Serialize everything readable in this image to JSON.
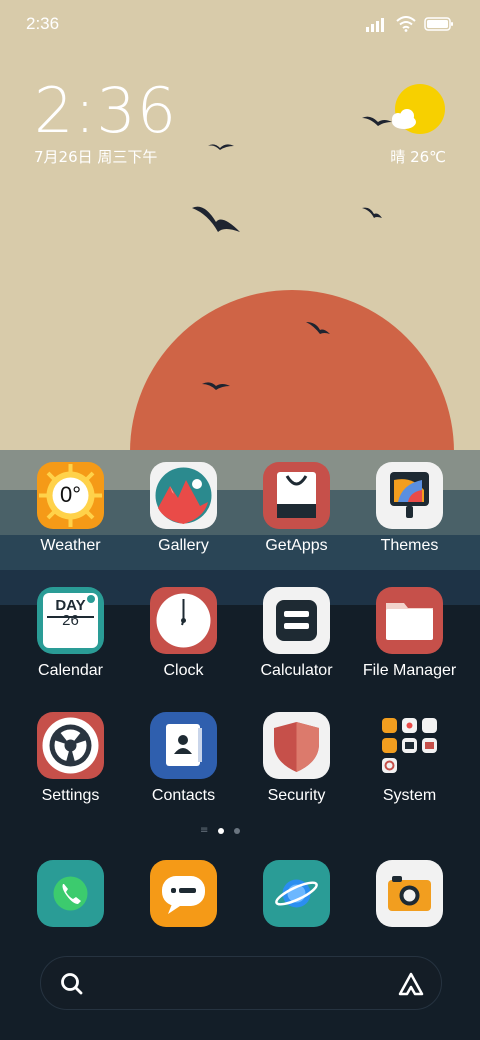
{
  "status_bar": {
    "time": "2:36",
    "icons": [
      "signal-icon",
      "wifi-icon",
      "battery-icon"
    ]
  },
  "clock_widget": {
    "time": "2:36",
    "date": "7月26日 周三下午"
  },
  "weather_widget": {
    "text": "晴 26℃",
    "icon": "sun-cloud-icon"
  },
  "apps": [
    {
      "label": "Weather",
      "icon": "weather-icon",
      "badge": "0°"
    },
    {
      "label": "Gallery",
      "icon": "gallery-icon"
    },
    {
      "label": "GetApps",
      "icon": "getapps-icon"
    },
    {
      "label": "Themes",
      "icon": "themes-icon"
    },
    {
      "label": "Calendar",
      "icon": "calendar-icon",
      "day_word": "DAY",
      "day_num": "26"
    },
    {
      "label": "Clock",
      "icon": "clock-icon"
    },
    {
      "label": "Calculator",
      "icon": "calculator-icon"
    },
    {
      "label": "File Manager",
      "icon": "folder-icon"
    },
    {
      "label": "Settings",
      "icon": "settings-icon"
    },
    {
      "label": "Contacts",
      "icon": "contacts-icon"
    },
    {
      "label": "Security",
      "icon": "security-icon"
    },
    {
      "label": "System",
      "icon": "system-folder-icon"
    }
  ],
  "page_indicator": {
    "pages": 2,
    "current": 1
  },
  "dock": [
    {
      "name": "Phone",
      "icon": "phone-icon"
    },
    {
      "name": "Messages",
      "icon": "messages-icon"
    },
    {
      "name": "Browser",
      "icon": "browser-icon"
    },
    {
      "name": "Camera",
      "icon": "camera-icon"
    }
  ],
  "search_bar": {
    "icon": "search-icon",
    "assistant_icon": "assistant-icon"
  },
  "colors": {
    "sky": "#d8cbaa",
    "sun": "#cf6446",
    "sea_1": "#879089",
    "sea_2": "#4a6168",
    "sea_3": "#2a4556",
    "sea_4": "#1e3346",
    "deep": "#131e28"
  }
}
